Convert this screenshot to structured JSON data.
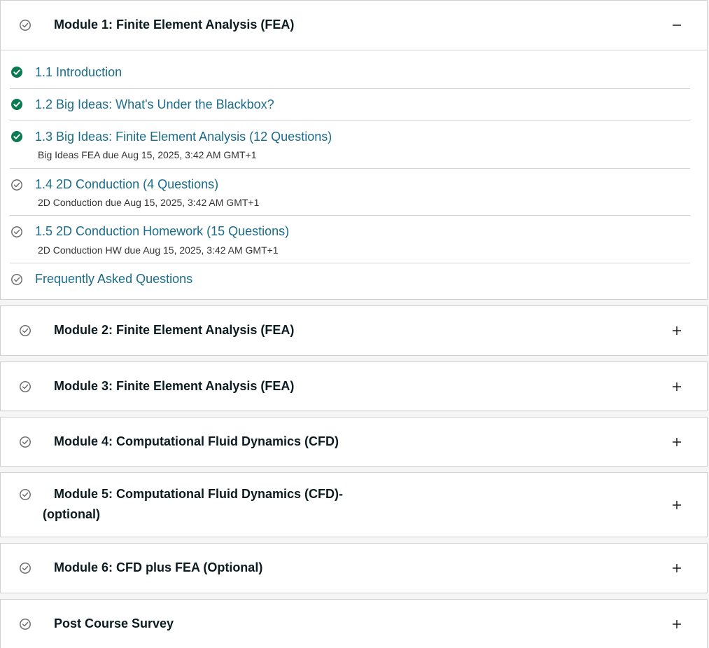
{
  "modules": [
    {
      "title": "Module 1: Finite Element Analysis (FEA)",
      "toggle": "collapse",
      "lessons": [
        {
          "label": "1.1 Introduction",
          "status": "complete",
          "due": ""
        },
        {
          "label": "1.2 Big Ideas: What's Under the Blackbox?",
          "status": "complete",
          "due": ""
        },
        {
          "label": "1.3 Big Ideas: Finite Element Analysis (12 Questions)",
          "status": "complete",
          "due": "Big Ideas FEA due Aug 15, 2025, 3:42 AM GMT+1"
        },
        {
          "label": "1.4 2D Conduction (4 Questions)",
          "status": "incomplete",
          "due": "2D Conduction due Aug 15, 2025, 3:42 AM GMT+1"
        },
        {
          "label": "1.5 2D Conduction Homework (15 Questions)",
          "status": "incomplete",
          "due": "2D Conduction HW due Aug 15, 2025, 3:42 AM GMT+1"
        },
        {
          "label": "Frequently Asked Questions",
          "status": "incomplete",
          "due": ""
        }
      ]
    },
    {
      "title": "Module 2: Finite Element Analysis (FEA)",
      "toggle": "expand"
    },
    {
      "title": "Module 3: Finite Element Analysis (FEA)",
      "toggle": "expand"
    },
    {
      "title": "Module 4: Computational Fluid Dynamics (CFD)",
      "toggle": "expand"
    },
    {
      "title": "Module 5: Computational Fluid Dynamics (CFD)- (optional)",
      "toggle": "expand"
    },
    {
      "title": "Module 6: CFD plus FEA (Optional)",
      "toggle": "expand"
    },
    {
      "title": "Post Course Survey",
      "toggle": "expand"
    }
  ],
  "icons": {
    "complete": "check-circle-filled",
    "incomplete": "check-circle-outline",
    "expand": "plus",
    "collapse": "minus"
  },
  "colors": {
    "complete_green": "#0a7a52",
    "link_blue": "#1a6c8b",
    "muted_gray": "#6f6f6f"
  }
}
